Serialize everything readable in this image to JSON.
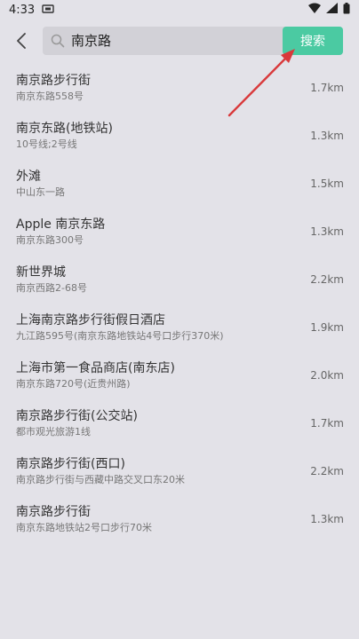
{
  "status": {
    "time": "4:33",
    "notification_icon": "sim-card-icon",
    "icons": [
      "wifi-icon",
      "signal-icon",
      "battery-icon"
    ]
  },
  "search": {
    "query": "南京路",
    "button_label": "搜索"
  },
  "results": [
    {
      "name": "南京路步行街",
      "address": "南京东路558号",
      "distance": "1.7km"
    },
    {
      "name": "南京东路(地铁站)",
      "address": "10号线;2号线",
      "distance": "1.3km"
    },
    {
      "name": "外滩",
      "address": "中山东一路",
      "distance": "1.5km"
    },
    {
      "name": "Apple 南京东路",
      "address": "南京东路300号",
      "distance": "1.3km"
    },
    {
      "name": "新世界城",
      "address": "南京西路2-68号",
      "distance": "2.2km"
    },
    {
      "name": "上海南京路步行街假日酒店",
      "address": "九江路595号(南京东路地铁站4号口步行370米)",
      "distance": "1.9km"
    },
    {
      "name": "上海市第一食品商店(南东店)",
      "address": "南京东路720号(近贵州路)",
      "distance": "2.0km"
    },
    {
      "name": "南京路步行街(公交站)",
      "address": "都市观光旅游1线",
      "distance": "1.7km"
    },
    {
      "name": "南京路步行街(西口)",
      "address": "南京路步行街与西藏中路交叉口东20米",
      "distance": "2.2km"
    },
    {
      "name": "南京路步行街",
      "address": "南京东路地铁站2号口步行70米",
      "distance": "1.3km"
    }
  ],
  "colors": {
    "accent": "#4bcaa2",
    "annotation_arrow": "#d9393b",
    "background": "#e3e2e8"
  }
}
